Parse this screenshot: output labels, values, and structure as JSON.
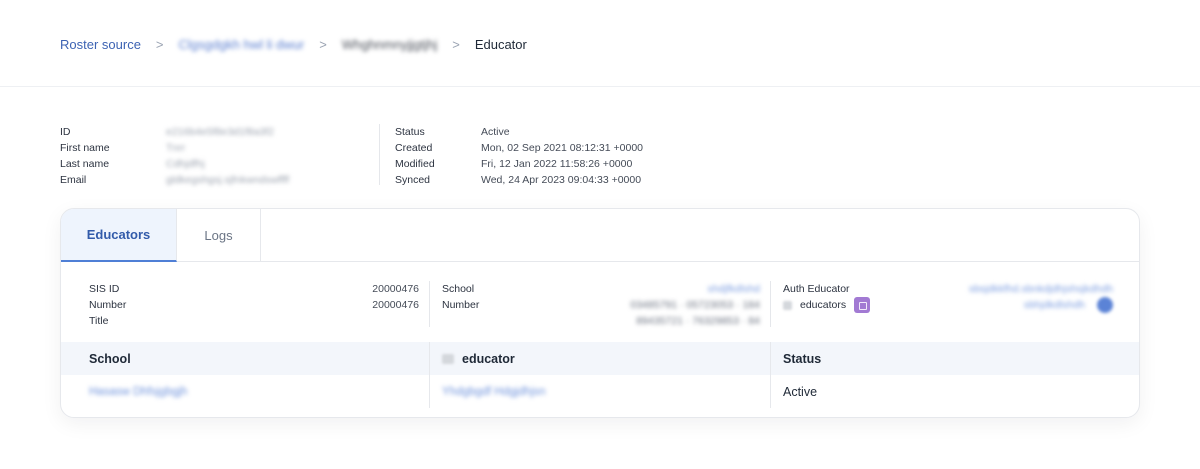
{
  "breadcrumb": {
    "root": "Roster source",
    "item2": "Clgsgdgkh hwl li dwur",
    "item3": "Whghnmnyjjgtjhj",
    "current": "Educator",
    "separator": ">"
  },
  "meta_left": {
    "rows": [
      {
        "label": "ID",
        "value": "e216b4e5f8e3d1f8a3f2"
      },
      {
        "label": "First name",
        "value": "Tnrr"
      },
      {
        "label": "Last name",
        "value": "Cdhjdfhj"
      },
      {
        "label": "Email",
        "value": "gldkegshgsj.sjfnkwndswffff"
      }
    ]
  },
  "meta_right": {
    "rows": [
      {
        "label": "Status",
        "value": "Active"
      },
      {
        "label": "Created",
        "value": "Mon, 02 Sep 2021 08:12:31 +0000"
      },
      {
        "label": "Modified",
        "value": "Fri, 12 Jan 2022 11:58:26 +0000"
      },
      {
        "label": "Synced",
        "value": "Wed, 24 Apr 2023 09:04:33 +0000"
      }
    ]
  },
  "tabs": {
    "educators": "Educators",
    "logs": "Logs"
  },
  "detail": {
    "col1": {
      "sis_id_label": "SIS ID",
      "sis_id_value": "20000476",
      "number_label": "Number",
      "number_value": "20000476",
      "title_label": "Title"
    },
    "col2": {
      "school_label": "School",
      "school_value": "shdjfkdlshd",
      "number_label": "Number",
      "number_line1": "03485791 · 05723053 · 184",
      "number_line2": "89435721 · 76329853 · 84"
    },
    "col3": {
      "auth_label": "Auth Educator",
      "auth_value": "sbsjdkkfhd.sbnkdjdhjshsjkdhdh",
      "educators_label": "educators",
      "second_value": "sbhjdkdlshdh"
    }
  },
  "table": {
    "headers": {
      "school": "School",
      "educator": "educator",
      "status": "Status"
    },
    "rows": [
      {
        "school": "Hasasw Dhfsjgbgjh",
        "educator": "Yhdgbgdf Hdgjdhjsn",
        "status": "Active"
      }
    ]
  },
  "colors": {
    "accent": "#4f7fd6",
    "link": "#3d63b3",
    "badge": "#a27ad3",
    "header_bg": "#f3f6fb",
    "tab_active_bg": "#eef4fd"
  }
}
